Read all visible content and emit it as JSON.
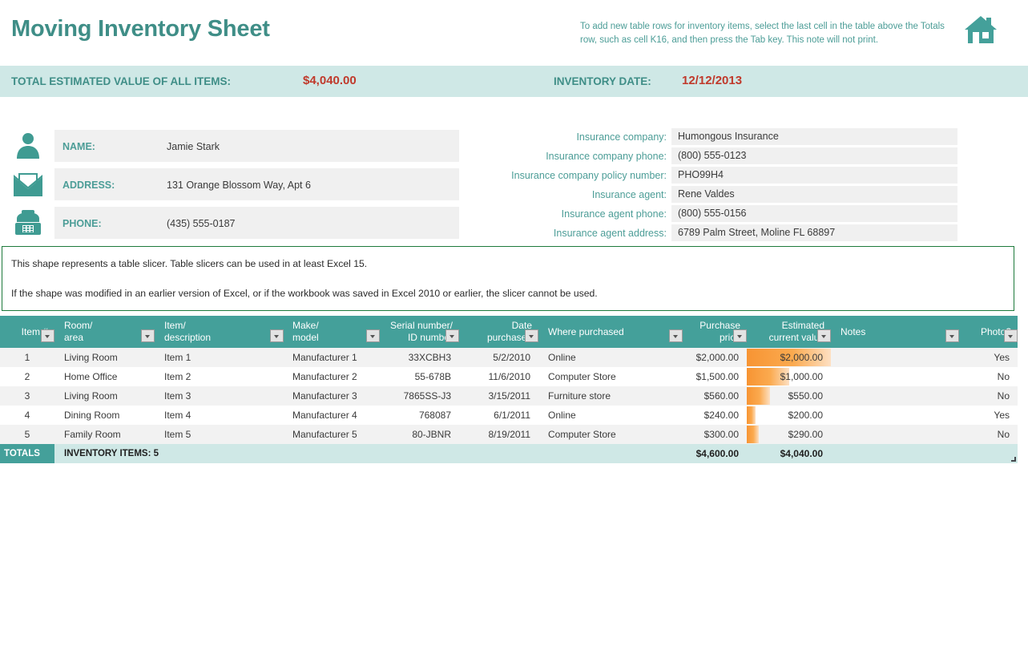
{
  "header": {
    "title": "Moving Inventory Sheet",
    "note": "To add new table rows for inventory items, select the last cell in the table above the Totals row, such as cell K16, and then press the Tab key. This note will not print.",
    "house_icon": "house-icon",
    "accent_teal": "#44a09a",
    "title_teal": "#3f8e87",
    "band_teal": "#cfe8e6",
    "value_red": "#c0392b",
    "bar_orange": "#f79433"
  },
  "summary_band": {
    "total_label": "TOTAL ESTIMATED VALUE OF ALL ITEMS:",
    "total_value": "$4,040.00",
    "date_label": "INVENTORY DATE:",
    "date_value": "12/12/2013"
  },
  "contact": {
    "rows": [
      {
        "icon": "person-icon",
        "label": "NAME:",
        "value": "Jamie Stark"
      },
      {
        "icon": "envelope-icon",
        "label": "ADDRESS:",
        "value": "131 Orange Blossom Way, Apt 6"
      },
      {
        "icon": "telephone-icon",
        "label": "PHONE:",
        "value": "(435) 555-0187"
      }
    ]
  },
  "insurance": {
    "rows": [
      {
        "label": "Insurance company:",
        "value": "Humongous Insurance"
      },
      {
        "label": "Insurance company phone:",
        "value": "(800) 555-0123"
      },
      {
        "label": "Insurance company policy number:",
        "value": "PHO99H4"
      },
      {
        "label": "Insurance agent:",
        "value": "Rene Valdes"
      },
      {
        "label": "Insurance agent phone:",
        "value": "(800) 555-0156"
      },
      {
        "label": "Insurance agent address:",
        "value": "6789 Palm Street, Moline FL 68897"
      }
    ]
  },
  "slicer_note": {
    "line1": "This shape represents a table slicer. Table slicers can be used in at least Excel 15.",
    "line2": "If the shape was modified in an earlier version of Excel, or if the workbook was saved in Excel 2010 or earlier, the slicer cannot be used.",
    "border_color": "#1e7a3c"
  },
  "table": {
    "columns": [
      {
        "line1": "Item #",
        "line2": ""
      },
      {
        "line1": "Room/",
        "line2": "area"
      },
      {
        "line1": "Item/",
        "line2": "description"
      },
      {
        "line1": "Make/",
        "line2": "model"
      },
      {
        "line1": "Serial number/",
        "line2": "ID number"
      },
      {
        "line1": "Date",
        "line2": "purchased"
      },
      {
        "line1": "Where purchased",
        "line2": ""
      },
      {
        "line1": "Purchase",
        "line2": "price"
      },
      {
        "line1": "Estimated",
        "line2": "current value"
      },
      {
        "line1": "Notes",
        "line2": ""
      },
      {
        "line1": "Photo?",
        "line2": ""
      }
    ],
    "rows": [
      {
        "item": "1",
        "room": "Living Room",
        "description": "Item 1",
        "make": "Manufacturer 1",
        "serial": "33XCBH3",
        "date": "5/2/2010",
        "where": "Online",
        "price": "$2,000.00",
        "value": "$2,000.00",
        "value_num": 2000,
        "notes": "",
        "photo": "Yes"
      },
      {
        "item": "2",
        "room": "Home Office",
        "description": "Item 2",
        "make": "Manufacturer 2",
        "serial": "55-678B",
        "date": "11/6/2010",
        "where": "Computer Store",
        "price": "$1,500.00",
        "value": "$1,000.00",
        "value_num": 1000,
        "notes": "",
        "photo": "No"
      },
      {
        "item": "3",
        "room": "Living Room",
        "description": "Item 3",
        "make": "Manufacturer 3",
        "serial": "7865SS-J3",
        "date": "3/15/2011",
        "where": "Furniture store",
        "price": "$560.00",
        "value": "$550.00",
        "value_num": 550,
        "notes": "",
        "photo": "No"
      },
      {
        "item": "4",
        "room": "Dining Room",
        "description": "Item 4",
        "make": "Manufacturer 4",
        "serial": "768087",
        "date": "6/1/2011",
        "where": "Online",
        "price": "$240.00",
        "value": "$200.00",
        "value_num": 200,
        "notes": "",
        "photo": "Yes"
      },
      {
        "item": "5",
        "room": "Family Room",
        "description": "Item 5",
        "make": "Manufacturer 5",
        "serial": "80-JBNR",
        "date": "8/19/2011",
        "where": "Computer Store",
        "price": "$300.00",
        "value": "$290.00",
        "value_num": 290,
        "notes": "",
        "photo": "No"
      }
    ],
    "footer": {
      "tag": "TOTALS",
      "items_label": "INVENTORY ITEMS: 5",
      "price_total": "$4,600.00",
      "value_total": "$4,040.00"
    },
    "databar_max": 2000
  }
}
